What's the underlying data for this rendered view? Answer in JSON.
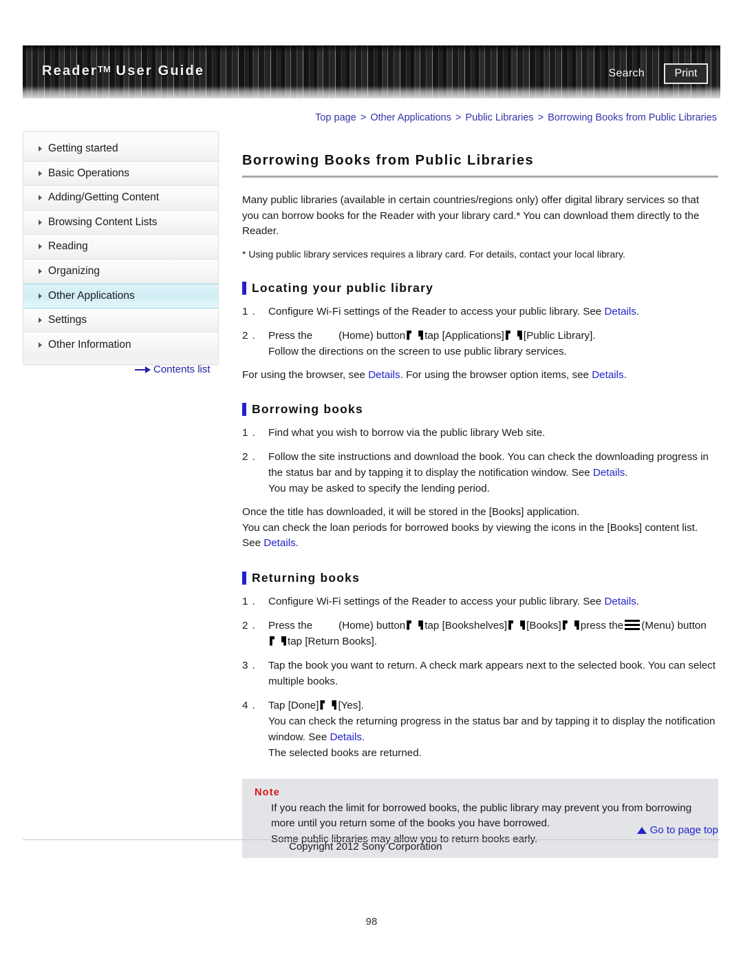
{
  "header": {
    "title_main": "Reader",
    "title_tm": "TM",
    "title_rest": " User Guide",
    "search_label": "Search",
    "print_label": "Print"
  },
  "breadcrumb": {
    "items": [
      "Top page",
      "Other Applications",
      "Public Libraries",
      "Borrowing Books from Public Libraries"
    ],
    "separator": ">"
  },
  "sidebar": {
    "items": [
      {
        "label": "Getting started",
        "active": false
      },
      {
        "label": "Basic Operations",
        "active": false
      },
      {
        "label": "Adding/Getting Content",
        "active": false
      },
      {
        "label": "Browsing Content Lists",
        "active": false
      },
      {
        "label": "Reading",
        "active": false
      },
      {
        "label": "Organizing",
        "active": false
      },
      {
        "label": "Other Applications",
        "active": true
      },
      {
        "label": "Settings",
        "active": false
      },
      {
        "label": "Other Information",
        "active": false
      }
    ],
    "contents_link": "Contents list"
  },
  "main": {
    "page_title": "Borrowing Books from Public Libraries",
    "intro": "Many public libraries (available in certain countries/regions only) offer digital library services so that you can borrow books for the Reader with your library card.* You can download them directly to the Reader.",
    "footnote": "* Using public library services requires a library card. For details, contact your local library.",
    "section1": {
      "heading": "Locating your public library",
      "step1_a": "Configure Wi-Fi settings of the Reader to access your public library. See ",
      "step1_link": "Details",
      "step1_b": ".",
      "step1_num": "1 .",
      "step2_num": "2 .",
      "step2_a": "Press the",
      "step2_b": "(Home) button",
      "step2_c": "tap [Applications]",
      "step2_d": "[Public Library].",
      "step2_sub": "Follow the directions on the screen to use public library services.",
      "trailer_a": "For using the browser, see ",
      "trailer_link1": "Details",
      "trailer_b": ". For using the browser option items, see ",
      "trailer_link2": "Details",
      "trailer_c": "."
    },
    "section2": {
      "heading": "Borrowing books",
      "step1_num": "1 .",
      "step1": "Find what you wish to borrow via the public library Web site.",
      "step2_num": "2 .",
      "step2_a": "Follow the site instructions and download the book. You can check the downloading progress in the status bar and by tapping it to display the notification window. See ",
      "step2_link": "Details",
      "step2_b": ".",
      "step2_sub": "You may be asked to specify the lending period.",
      "trailer1": "Once the title has downloaded, it will be stored in the [Books] application.",
      "trailer2_a": "You can check the loan periods for borrowed books by viewing the icons in the [Books] content list. See ",
      "trailer2_link": "Details",
      "trailer2_b": "."
    },
    "section3": {
      "heading": "Returning books",
      "step1_num": "1 .",
      "step1_a": "Configure Wi-Fi settings of the Reader to access your public library. See ",
      "step1_link": "Details",
      "step1_b": ".",
      "step2_num": "2 .",
      "step2_a": "Press the",
      "step2_b": "(Home) button",
      "step2_c": "tap [Bookshelves]",
      "step2_d": "[Books]",
      "step2_e": "press the",
      "step2_f": "(Menu) button",
      "step2_g": "tap [Return Books].",
      "step3_num": "3 .",
      "step3": "Tap the book you want to return. A check mark appears next to the selected book. You can select multiple books.",
      "step4_num": "4 .",
      "step4_a": "Tap [Done]",
      "step4_b": "[Yes].",
      "step4_sub_a": "You can check the returning progress in the status bar and by tapping it to display the notification window. See ",
      "step4_sub_link": "Details",
      "step4_sub_b": ".",
      "step4_sub2": "The selected books are returned."
    },
    "note": {
      "title": "Note",
      "line1": "If you reach the limit for borrowed books, the public library may prevent you from borrowing more until you return some of the books you have borrowed.",
      "line2": "Some public libraries may allow you to return books early."
    }
  },
  "footer": {
    "go_to_top": "Go to page top",
    "copyright": "Copyright 2012 Sony Corporation",
    "page_number": "98"
  },
  "colors": {
    "link": "#2222cc",
    "breadcrumb": "#3333aa",
    "note_title": "#d81414",
    "section_bar": "#2222cc",
    "active_nav": "#cfeef6"
  }
}
